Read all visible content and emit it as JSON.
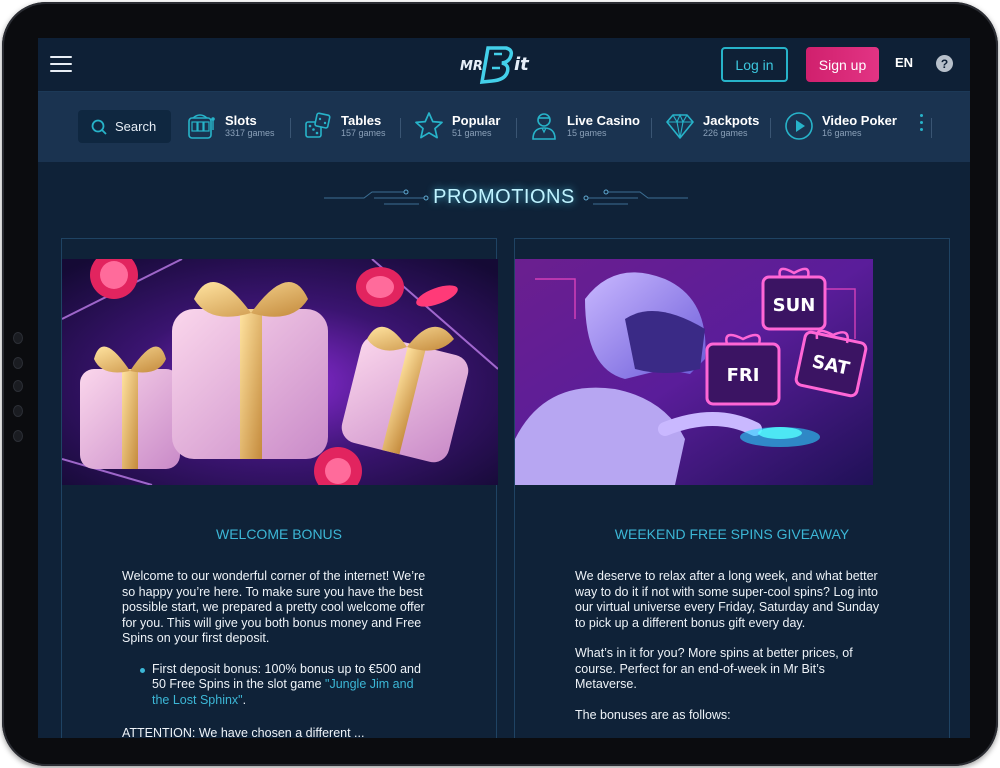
{
  "header": {
    "logo_text": "MR Bit",
    "login_label": "Log in",
    "signup_label": "Sign up",
    "language": "EN",
    "help_label": "?"
  },
  "nav": {
    "search_label": "Search",
    "categories": [
      {
        "name": "Slots",
        "count": "3317 games",
        "icon": "slot-machine-icon"
      },
      {
        "name": "Tables",
        "count": "157 games",
        "icon": "dice-icon"
      },
      {
        "name": "Popular",
        "count": "51 games",
        "icon": "star-icon"
      },
      {
        "name": "Live Casino",
        "count": "15 games",
        "icon": "dealer-icon"
      },
      {
        "name": "Jackpots",
        "count": "226 games",
        "icon": "diamond-icon"
      },
      {
        "name": "Video Poker",
        "count": "16 games",
        "icon": "play-icon"
      }
    ]
  },
  "page": {
    "title": "PROMOTIONS"
  },
  "promos": [
    {
      "title": "WELCOME BONUS",
      "image_icon": "gift-boxes-image",
      "intro": "Welcome to our wonderful corner of the internet! We’re so happy you’re here. To make sure you have the best possible start, we prepared a pretty cool welcome offer for you. This will give you both bonus money and Free Spins on your first deposit.",
      "bullet_text": "First deposit bonus: 100% bonus up to €500 and 50 Free Spins in the slot game ",
      "bullet_link": "\"Jungle Jim and the Lost Sphinx\"",
      "bullet_end": ".",
      "cut_text": "ATTENTION: We have chosen a different ..."
    },
    {
      "title": "WEEKEND FREE SPINS GIVEAWAY",
      "image_icon": "robot-weekend-gifts-image",
      "image_labels": [
        "SUN",
        "FRI",
        "SAT"
      ],
      "p1": "We deserve to relax after a long week, and what better way to do it if not with some super-cool spins? Log into our virtual universe every Friday, Saturday and Sunday to pick up a different bonus gift every day.",
      "p2": "What’s in it for you? More spins at better prices, of course. Perfect for an end-of-week in Mr Bit’s Metaverse.",
      "p3": "The bonuses are as follows:"
    }
  ],
  "colors": {
    "accent": "#27b3c9",
    "signup": "#d0206d",
    "background": "#0f2238"
  }
}
